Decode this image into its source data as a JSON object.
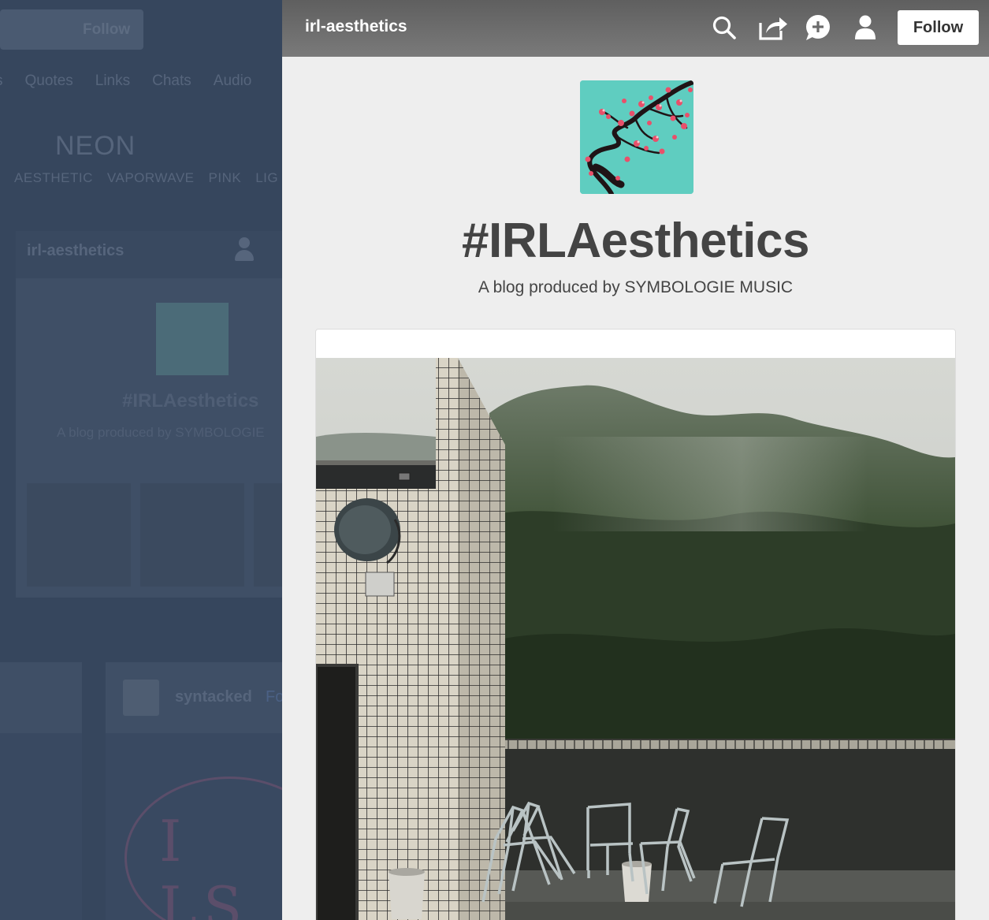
{
  "background": {
    "follow_label": "Follow",
    "post_types": [
      "s",
      "Quotes",
      "Links",
      "Chats",
      "Audio"
    ],
    "neon_title": "NEON",
    "tags": [
      "AESTHETIC",
      "VAPORWAVE",
      "PINK",
      "LIG"
    ],
    "card": {
      "blog_name": "irl-aesthetics",
      "title": "#IRLAesthetics",
      "description": "A blog produced by SYMBOLOGIE"
    },
    "post_author": "syntacked",
    "post_follow": "Fo",
    "scribble_text": "I LS"
  },
  "header": {
    "blog_name": "irl-aesthetics",
    "follow_label": "Follow",
    "icons": [
      "search-icon",
      "share-icon",
      "message-icon",
      "user-icon"
    ]
  },
  "blog": {
    "title": "#IRLAesthetics",
    "description": "A blog produced by SYMBOLOGIE MUSIC"
  },
  "colors": {
    "panel_bg": "#eeeeee",
    "topbar": "#6b6b6b",
    "dim_overlay": "#36465d",
    "avatar_bg": "#5fcdc0"
  }
}
